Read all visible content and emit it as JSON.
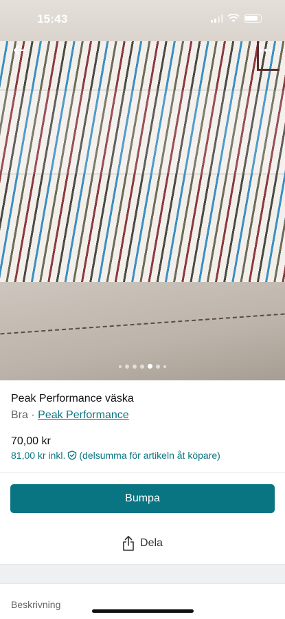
{
  "status_bar": {
    "time": "15:43"
  },
  "item": {
    "title": "Peak Performance väska",
    "condition": "Bra",
    "separator": "·",
    "brand": "Peak Performance",
    "price": "70,00 kr",
    "price_incl": "81,00 kr inkl.",
    "price_incl_note": "(delsumma för artikeln åt köpare)"
  },
  "gallery": {
    "total": 7,
    "active_index": 4
  },
  "actions": {
    "bump_label": "Bumpa",
    "share_label": "Dela"
  },
  "sections": {
    "description_label": "Beskrivning"
  },
  "colors": {
    "accent": "#097582",
    "muted_text": "#666666"
  }
}
